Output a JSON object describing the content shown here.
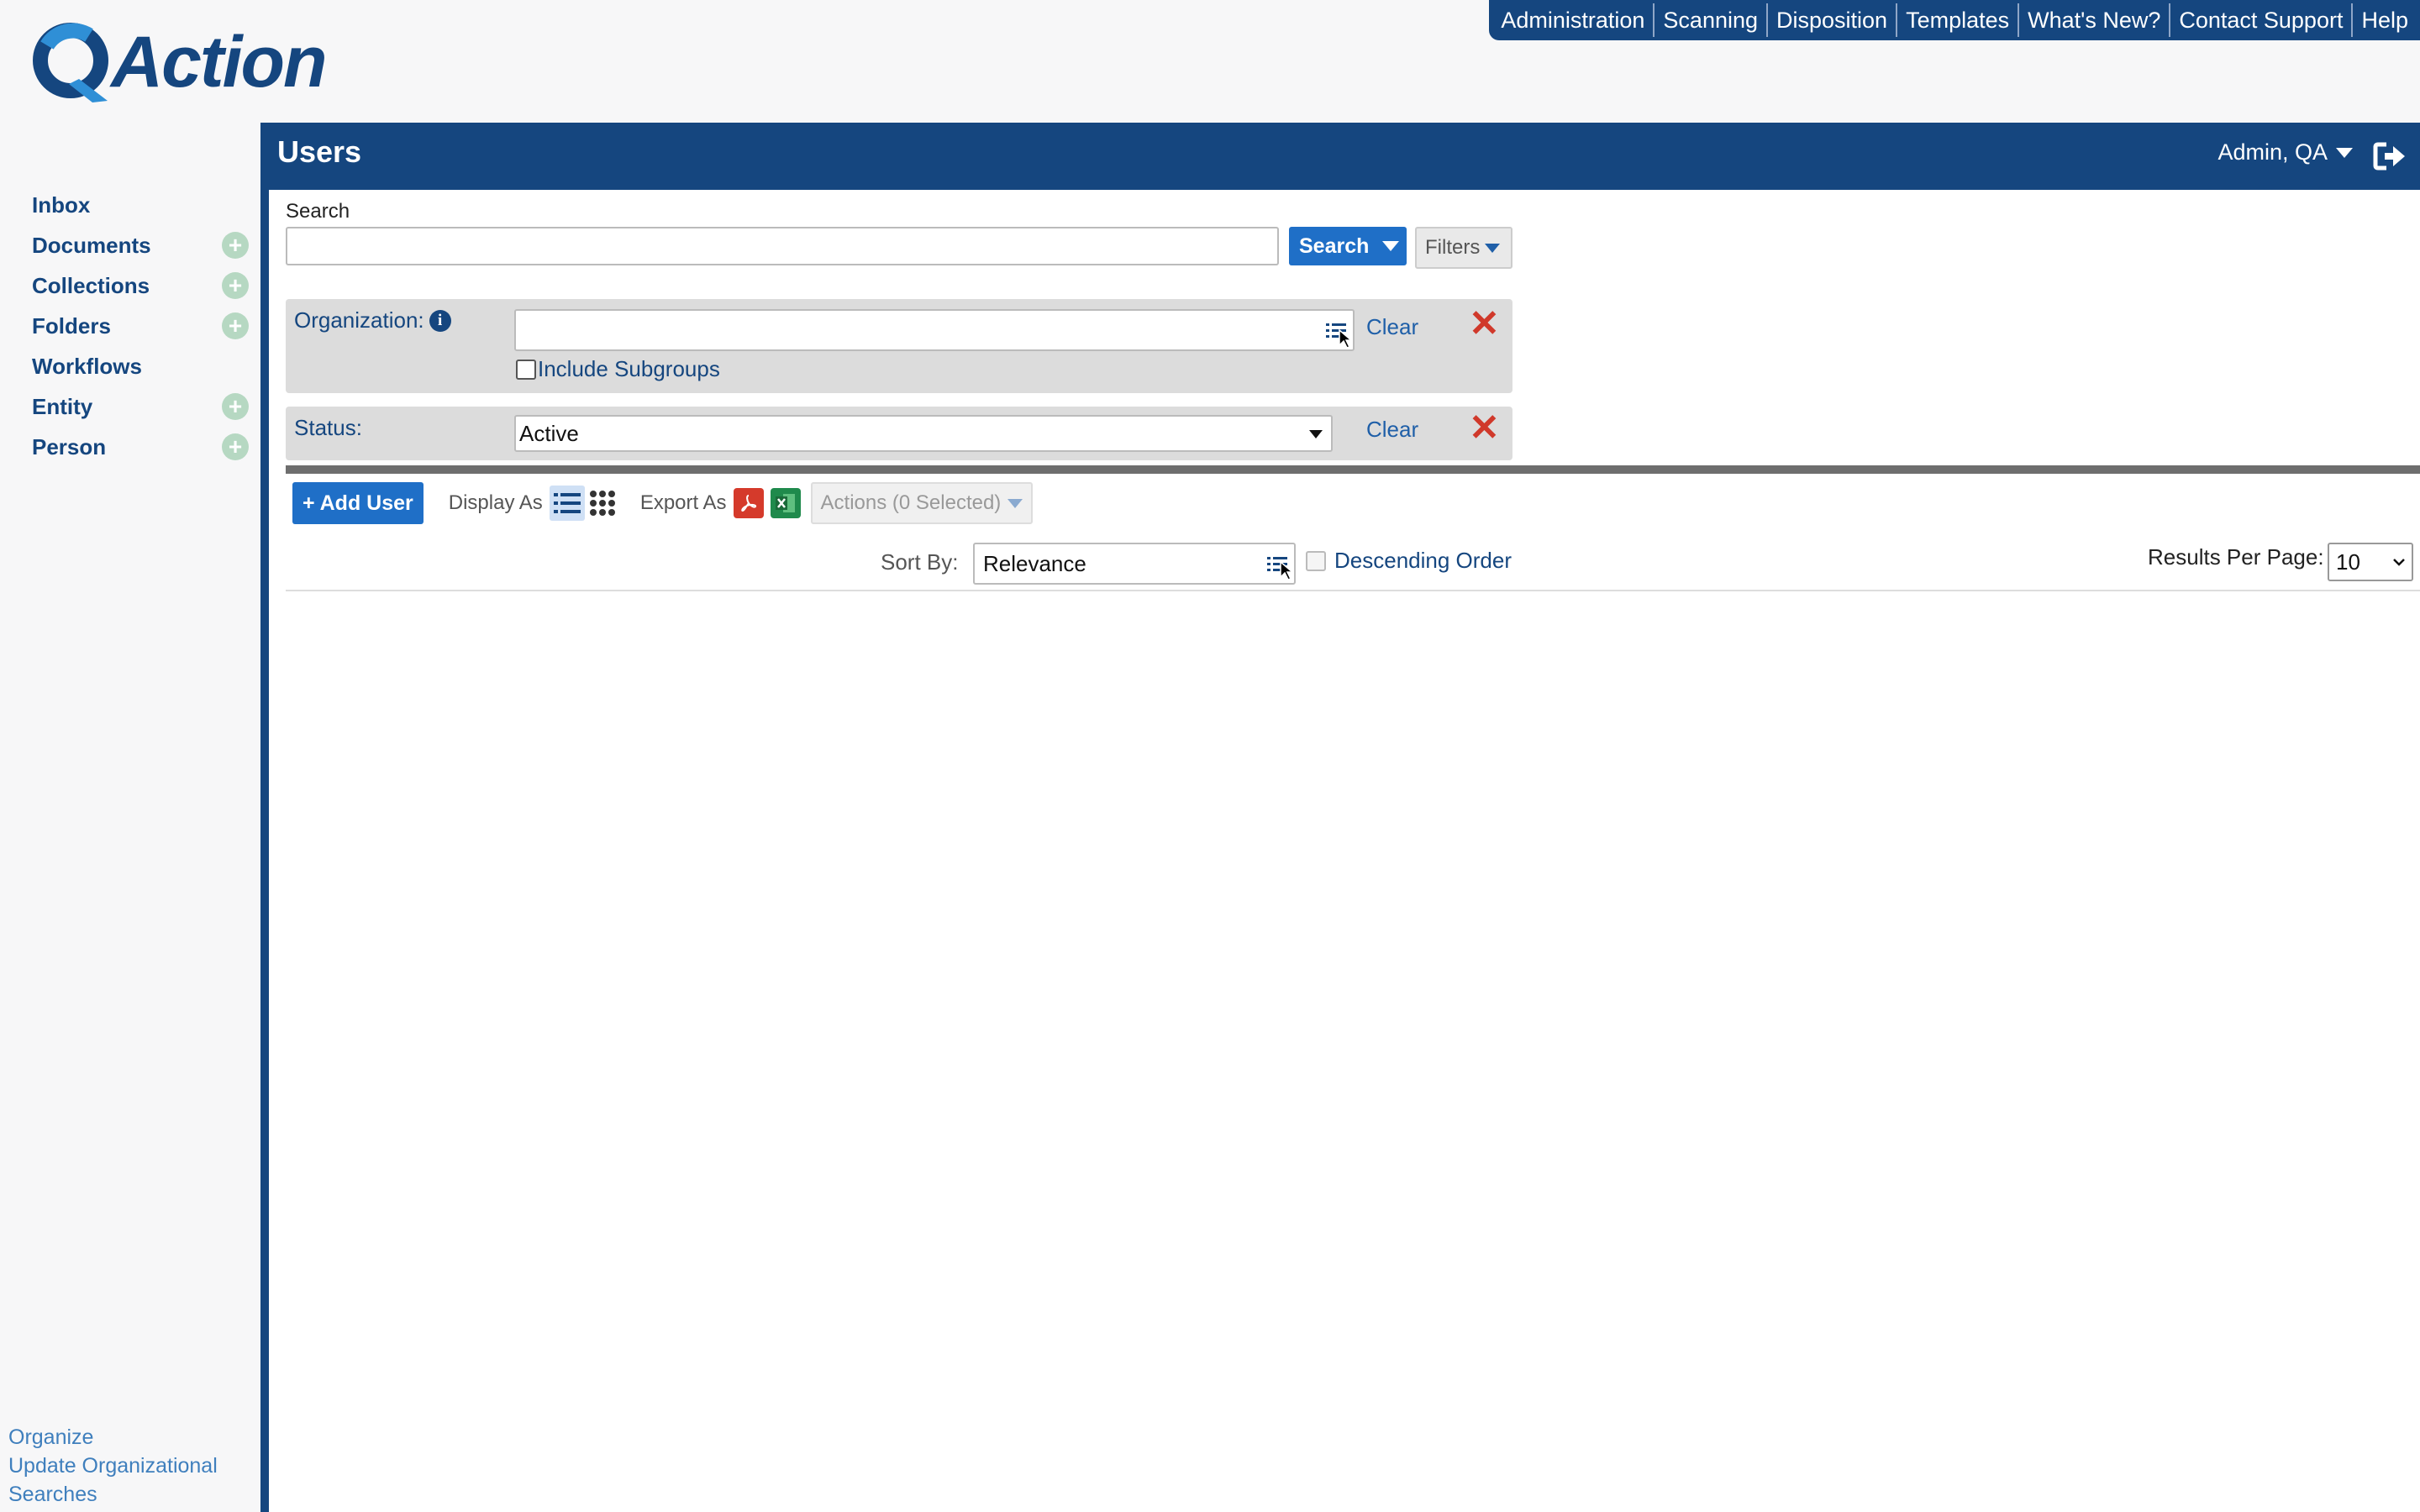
{
  "logo": {
    "text": "Action"
  },
  "topnav": [
    "Administration",
    "Scanning",
    "Disposition",
    "Templates",
    "What's New?",
    "Contact Support",
    "Help"
  ],
  "sidebar": {
    "items": [
      {
        "label": "Inbox",
        "has_add": false
      },
      {
        "label": "Documents",
        "has_add": true
      },
      {
        "label": "Collections",
        "has_add": true
      },
      {
        "label": "Folders",
        "has_add": true
      },
      {
        "label": "Workflows",
        "has_add": false
      },
      {
        "label": "Entity",
        "has_add": true
      },
      {
        "label": "Person",
        "has_add": true
      }
    ],
    "bottom_links": [
      "Organize",
      "Update Organizational Searches"
    ]
  },
  "header": {
    "title": "Users",
    "user": "Admin, QA"
  },
  "search": {
    "label": "Search",
    "value": "",
    "button": "Search",
    "filters_button": "Filters"
  },
  "filters": {
    "organization": {
      "label": "Organization:",
      "value": "",
      "include_subgroups": "Include Subgroups",
      "clear": "Clear"
    },
    "status": {
      "label": "Status:",
      "value": "Active",
      "clear": "Clear"
    }
  },
  "toolbar": {
    "add_user": "+ Add User",
    "display_as": "Display As",
    "export_as": "Export As",
    "actions": "Actions (0 Selected)"
  },
  "sort": {
    "label": "Sort By:",
    "value": "Relevance",
    "descending": "Descending Order",
    "rpp_label": "Results Per Page:",
    "rpp_value": "10"
  },
  "colors": {
    "brand": "#15467f",
    "button": "#1f6fc7",
    "danger": "#d0392b"
  }
}
